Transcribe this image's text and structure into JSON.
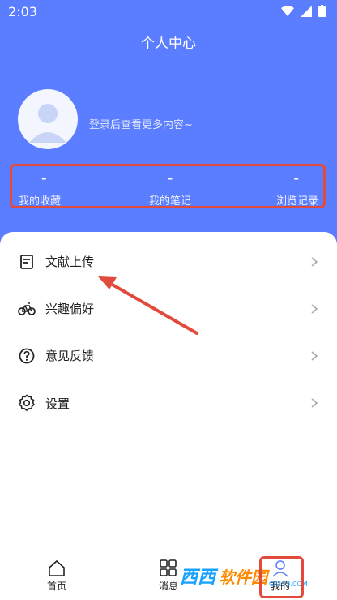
{
  "status_bar": {
    "time": "2:03"
  },
  "header": {
    "title": "个人中心"
  },
  "profile": {
    "login_hint": "登录后查看更多内容~"
  },
  "stats": [
    {
      "value": "-",
      "label": "我的收藏"
    },
    {
      "value": "-",
      "label": "我的笔记"
    },
    {
      "value": "-",
      "label": "浏览记录"
    }
  ],
  "menu": [
    {
      "label": "文献上传",
      "icon": "document-icon"
    },
    {
      "label": "兴趣偏好",
      "icon": "bicycle-icon"
    },
    {
      "label": "意见反馈",
      "icon": "question-icon"
    },
    {
      "label": "设置",
      "icon": "gear-icon"
    }
  ],
  "tabbar": [
    {
      "label": "首页",
      "icon": "home-icon"
    },
    {
      "label": "消息",
      "icon": "grid-icon"
    },
    {
      "label": "我的",
      "icon": "user-icon"
    }
  ],
  "watermark": {
    "brand": "西西",
    "site": "软件园",
    "url": "CR173.COM"
  },
  "colors": {
    "primary": "#5b7dff",
    "annotation": "#e24b3b"
  }
}
